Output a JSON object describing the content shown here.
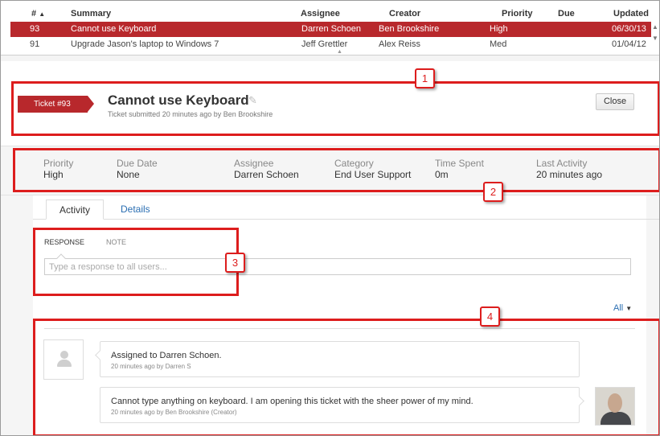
{
  "ticket_list": {
    "headers": {
      "number": "#",
      "summary": "Summary",
      "assignee": "Assignee",
      "creator": "Creator",
      "priority": "Priority",
      "due": "Due",
      "updated": "Updated"
    },
    "sort_indicator": "▲",
    "rows": [
      {
        "number": "93",
        "summary": "Cannot use Keyboard",
        "assignee": "Darren Schoen",
        "creator": "Ben Brookshire",
        "priority": "High",
        "due": "",
        "updated": "06/30/13",
        "selected": true
      },
      {
        "number": "91",
        "summary": "Upgrade Jason's laptop to Windows 7",
        "assignee": "Jeff Grettler",
        "creator": "Alex Reiss",
        "priority": "Med",
        "due": "",
        "updated": "01/04/12",
        "selected": false
      }
    ]
  },
  "ticket": {
    "tag": "Ticket #93",
    "title": "Cannot use Keyboard",
    "subtitle": "Ticket submitted 20 minutes ago by Ben Brookshire",
    "close_label": "Close"
  },
  "meta": [
    {
      "label": "Priority",
      "value": "High"
    },
    {
      "label": "Due Date",
      "value": "None"
    },
    {
      "label": "Assignee",
      "value": "Darren Schoen"
    },
    {
      "label": "Category",
      "value": "End User Support"
    },
    {
      "label": "Time Spent",
      "value": "0m"
    },
    {
      "label": "Last Activity",
      "value": "20 minutes ago"
    }
  ],
  "tabs": [
    {
      "label": "Activity",
      "active": true
    },
    {
      "label": "Details",
      "active": false
    }
  ],
  "response": {
    "tabs": [
      "RESPONSE",
      "NOTE"
    ],
    "placeholder": "Type a response to all users..."
  },
  "activity": {
    "filter_label": "All",
    "items": [
      {
        "text": "Assigned to Darren Schoen.",
        "meta": "20 minutes ago by Darren S"
      },
      {
        "text": "Cannot type anything on keyboard. I am opening this ticket with the sheer power of my mind.",
        "meta": "20 minutes ago by Ben Brookshire (Creator)"
      }
    ]
  },
  "callouts": [
    "1",
    "2",
    "3",
    "4"
  ],
  "colors": {
    "accent_red": "#b8282c",
    "callout_red": "#dd1d1d",
    "link_blue": "#2a6eb2"
  },
  "icons": {
    "edit": "pencil-icon",
    "avatar": "user-placeholder-icon",
    "sort": "sort-asc-icon",
    "dropdown": "caret-down-icon"
  }
}
